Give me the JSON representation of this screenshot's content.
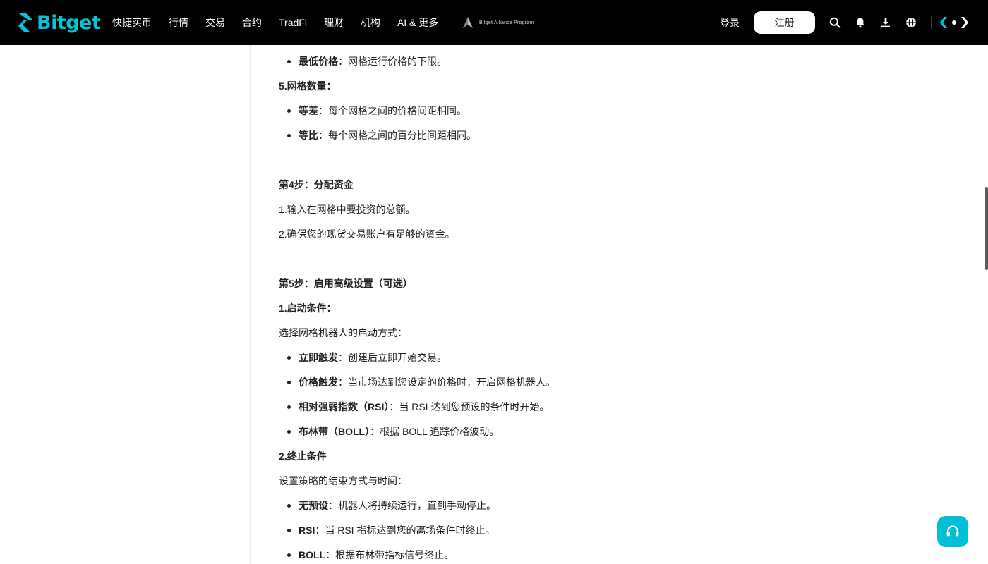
{
  "header": {
    "logo_text": "Bitget",
    "nav": [
      {
        "label": "快捷买币"
      },
      {
        "label": "行情"
      },
      {
        "label": "交易"
      },
      {
        "label": "合约"
      },
      {
        "label": "TradFi"
      },
      {
        "label": "理财"
      },
      {
        "label": "机构"
      },
      {
        "label": "AI & 更多"
      }
    ],
    "alliance_text": "Bitget Alliance Program",
    "login_label": "登录",
    "register_label": "注册",
    "icons": [
      "search-icon",
      "bell-icon",
      "download-icon",
      "globe-icon",
      "brand-logo-icon"
    ],
    "accent_color": "#00c6d8"
  },
  "article": {
    "l1": {
      "bold": "最低价格",
      "text": "：网格运行价格的下限。"
    },
    "l2": "5.网格数量：",
    "l3": {
      "bold": "等差",
      "text": "：每个网格之间的价格间距相同。"
    },
    "l4": {
      "bold": "等比",
      "text": "：每个网格之间的百分比间距相同。"
    },
    "l5": "第4步：分配资金",
    "l6": "1.输入在网格中要投资的总额。",
    "l7": "2.确保您的现货交易账户有足够的资金。",
    "l8": "第5步：启用高级设置（可选）",
    "l9": "1.启动条件：",
    "l10": "选择网格机器人的启动方式：",
    "l11": {
      "bold": "立即触发",
      "text": "：创建后立即开始交易。"
    },
    "l12": {
      "bold": "价格触发",
      "text": "：当市场达到您设定的价格时，开启网格机器人。"
    },
    "l13": {
      "bold": "相对强弱指数（RSI）",
      "text": "：当 RSI 达到您预设的条件时开始。"
    },
    "l14": {
      "bold": "布林带（BOLL）",
      "text": "：根据 BOLL 追踪价格波动。"
    },
    "l15": "2.终止条件",
    "l16": "设置策略的结束方式与时间：",
    "l17": {
      "bold": "无预设",
      "text": "：机器人将持续运行，直到手动停止。"
    },
    "l18": {
      "bold": "RSI",
      "text": "：当 RSI 指标达到您的离场条件时终止。"
    },
    "l19": {
      "bold": "BOLL",
      "text": "：根据布林带指标信号终止。"
    }
  },
  "support": {
    "icon": "headset-icon",
    "color": "#00bfd6"
  }
}
